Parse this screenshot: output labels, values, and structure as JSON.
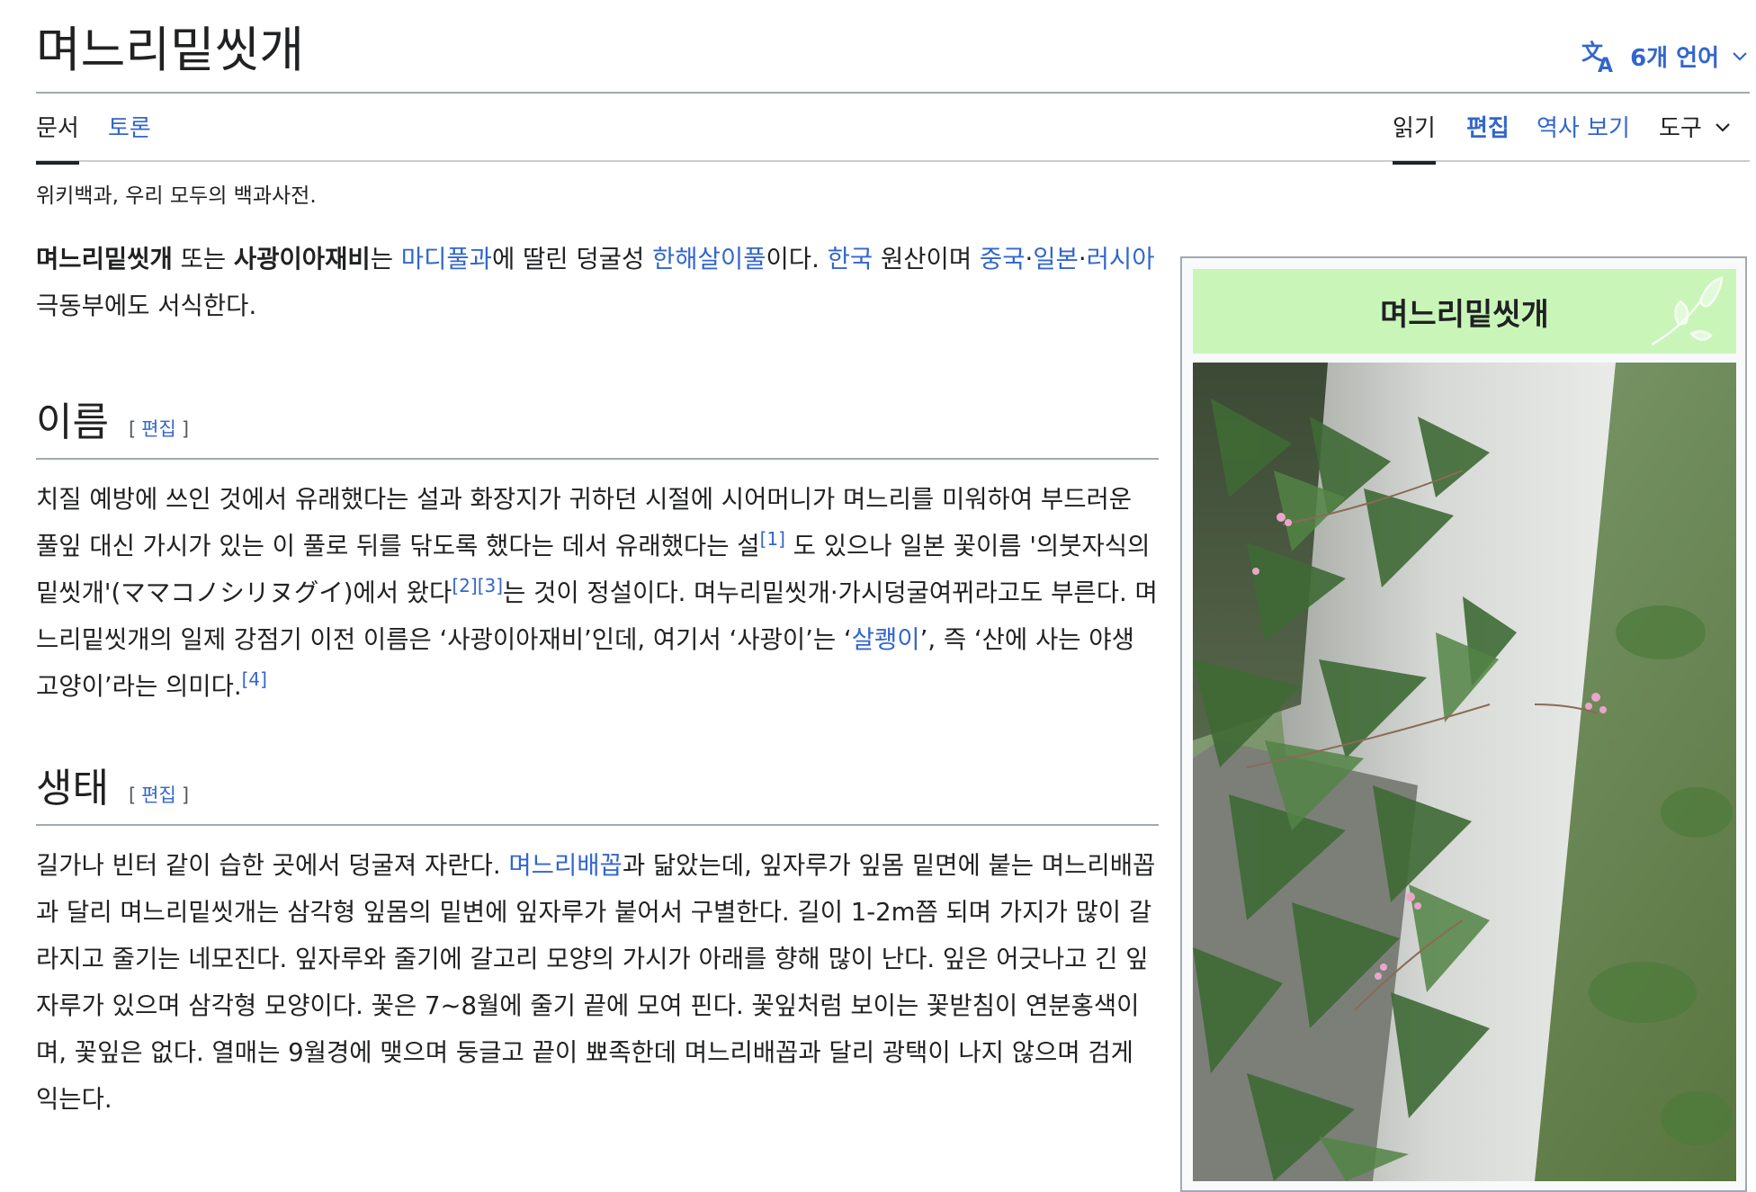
{
  "page": {
    "title": "며느리밑씻개",
    "lang_label": "6개 언어",
    "tagline": "위키백과, 우리 모두의 백과사전."
  },
  "tabs": {
    "article": "문서",
    "talk": "토론",
    "read": "읽기",
    "edit": "편집",
    "history": "역사 보기",
    "tools": "도구"
  },
  "intro": {
    "b1": "며느리밑씻개",
    "t1": " 또는 ",
    "b2": "사광이아재비",
    "t2": "는 ",
    "l1": "마디풀과",
    "t3": "에 딸린 덩굴성 ",
    "l2": "한해살이풀",
    "t4": "이다. ",
    "l3": "한국",
    "t5": " 원산이며 ",
    "l4": "중국",
    "t6": "·",
    "l5": "일본",
    "t7": "·",
    "l6": "러시아",
    "t8": " 극동부에도 서식한다."
  },
  "sec_name": {
    "heading": "이름",
    "bracket_open": "[",
    "edit": "편집",
    "bracket_close": "]",
    "t1": "치질 예방에 쓰인 것에서 유래했다는 설과 화장지가 귀하던 시절에 시어머니가 며느리를 미워하여 부드러운 풀잎 대신 가시가 있는 이 풀로 뒤를 닦도록 했다는 데서 유래했다는 설",
    "ref1": "[1]",
    "t2": " 도 있으나 일본 꽃이름 '의붓자식의 밑씻개'(ママコノシリヌグイ)에서 왔다",
    "ref2": "[2]",
    "ref3": "[3]",
    "t3": "는 것이 정설이다. 며누리밑씻개·가시덩굴여뀌라고도 부른다. 며느리밑씻개의 일제 강점기 이전 이름은 ‘사광이아재비’인데, 여기서 ‘사광이’는 ‘",
    "link": "살쾡이",
    "t4": "’, 즉 ‘산에 사는 야생 고양이’라는 의미다.",
    "ref4": "[4]"
  },
  "sec_eco": {
    "heading": "생태",
    "bracket_open": "[",
    "edit": "편집",
    "bracket_close": "]",
    "t1": "길가나 빈터 같이 습한 곳에서 덩굴져 자란다. ",
    "link": "며느리배꼽",
    "t2": "과 닮았는데, 잎자루가 잎몸 밑면에 붙는 며느리배꼽과 달리 며느리밑씻개는 삼각형 잎몸의 밑변에 잎자루가 붙어서 구별한다. 길이 1-2m쯤 되며 가지가 많이 갈라지고 줄기는 네모진다. 잎자루와 줄기에 갈고리 모양의 가시가 아래를 향해 많이 난다. 잎은 어긋나고 긴 잎자루가 있으며 삼각형 모양이다. 꽃은 7~8월에 줄기 끝에 모여 핀다. 꽃잎처럼 보이는 꽃받침이 연분홍색이며, 꽃잎은 없다. 열매는 9월경에 맺으며 둥글고 끝이 뾰족한데 며느리배꼽과 달리 광택이 나지 않으며 검게 익는다."
  },
  "infobox": {
    "title": "며느리밑씻개",
    "header_color": "#c9f5b9"
  },
  "colors": {
    "link": "#3366cc",
    "text": "#202122",
    "border": "#a2a9b1"
  },
  "icons": {
    "lang": "translate-icon",
    "lang_chevron": "chevron-down-icon",
    "tools_chevron": "chevron-down-icon",
    "infobox_deco": "leaf-icon"
  }
}
